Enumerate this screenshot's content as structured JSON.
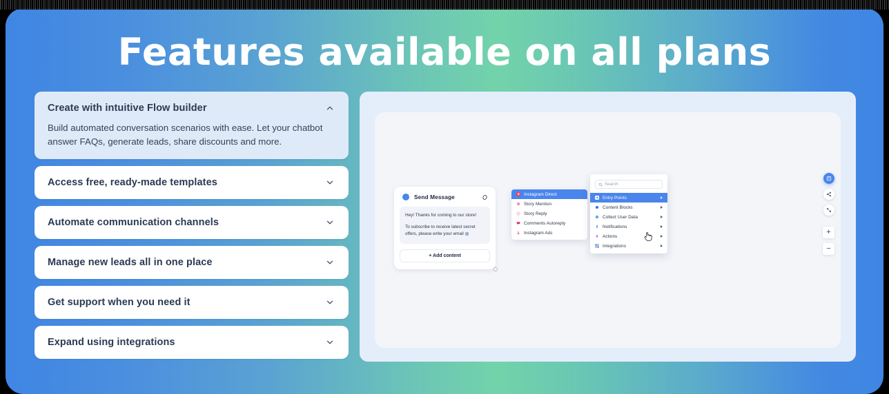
{
  "page": {
    "title": "Features available on all plans",
    "accent_color": "#4a85ec",
    "gradient_start": "#3f86e4",
    "gradient_mid": "#72d3aa",
    "gradient_end": "#3f86e4"
  },
  "accordion": {
    "items": [
      {
        "title": "Create with intuitive Flow builder",
        "body": "Build automated conversation scenarios with ease. Let your chatbot answer FAQs, generate leads, share discounts and more.",
        "expanded": true,
        "chevron": "chevron-up-icon"
      },
      {
        "title": "Access free, ready-made templates",
        "body": "",
        "expanded": false,
        "chevron": "chevron-down-icon"
      },
      {
        "title": "Automate communication channels",
        "body": "",
        "expanded": false,
        "chevron": "chevron-down-icon"
      },
      {
        "title": "Manage new leads all in one place",
        "body": "",
        "expanded": false,
        "chevron": "chevron-down-icon"
      },
      {
        "title": "Get support when you need it",
        "body": "",
        "expanded": false,
        "chevron": "chevron-down-icon"
      },
      {
        "title": "Expand using integrations",
        "body": "",
        "expanded": false,
        "chevron": "chevron-down-icon"
      }
    ]
  },
  "flow_builder": {
    "send_message_node": {
      "title": "Send Message",
      "dot_color": "#4a85ec",
      "head_icon": "link-icon",
      "message_line_1": "Hey! Thanks for coming to our store!",
      "message_line_2": "To subscribe to receive latest secret offers, please write your email",
      "add_content_label": "+ Add content"
    },
    "channel_menu": {
      "items": [
        {
          "label": "Instagram Direct",
          "icon": "instagram-direct-icon",
          "active": true,
          "color": "#e8486c"
        },
        {
          "label": "Story Mention",
          "icon": "story-mention-icon",
          "active": false,
          "color": "#ea5a84"
        },
        {
          "label": "Story Reply",
          "icon": "story-reply-icon",
          "active": false,
          "color": "#ec6a92"
        },
        {
          "label": "Comments Autoreply",
          "icon": "comments-autoreply-icon",
          "active": false,
          "color": "#d63a78"
        },
        {
          "label": "Instagram Ads",
          "icon": "instagram-ads-icon",
          "active": false,
          "color": "#d94a7c"
        }
      ]
    },
    "block_menu": {
      "search_placeholder": "Search",
      "search_icon": "search-icon",
      "items": [
        {
          "label": "Entry Points",
          "icon": "entry-points-icon",
          "active": true,
          "color": "#ffffff"
        },
        {
          "label": "Content Blocks",
          "icon": "content-blocks-icon",
          "active": false,
          "color": "#3a6fe0"
        },
        {
          "label": "Collect User Data",
          "icon": "collect-user-data-icon",
          "active": false,
          "color": "#3a8ee0"
        },
        {
          "label": "Notifications",
          "icon": "notifications-icon",
          "active": false,
          "color": "#5a8ce8"
        },
        {
          "label": "Actions",
          "icon": "actions-icon",
          "active": false,
          "color": "#a05ae8"
        },
        {
          "label": "Integrations",
          "icon": "integrations-icon",
          "active": false,
          "color": "#4a6ae0"
        }
      ]
    },
    "toolbar": {
      "buttons": [
        {
          "name": "flow-save-button",
          "icon": "flow-icon",
          "primary": true
        },
        {
          "name": "share-flow-button",
          "icon": "share-icon",
          "primary": false
        },
        {
          "name": "fit-view-button",
          "icon": "fit-view-icon",
          "primary": false
        }
      ],
      "zoom_in_label": "+",
      "zoom_out_label": "−"
    },
    "cursor_icon": "pointer-hand-cursor"
  }
}
